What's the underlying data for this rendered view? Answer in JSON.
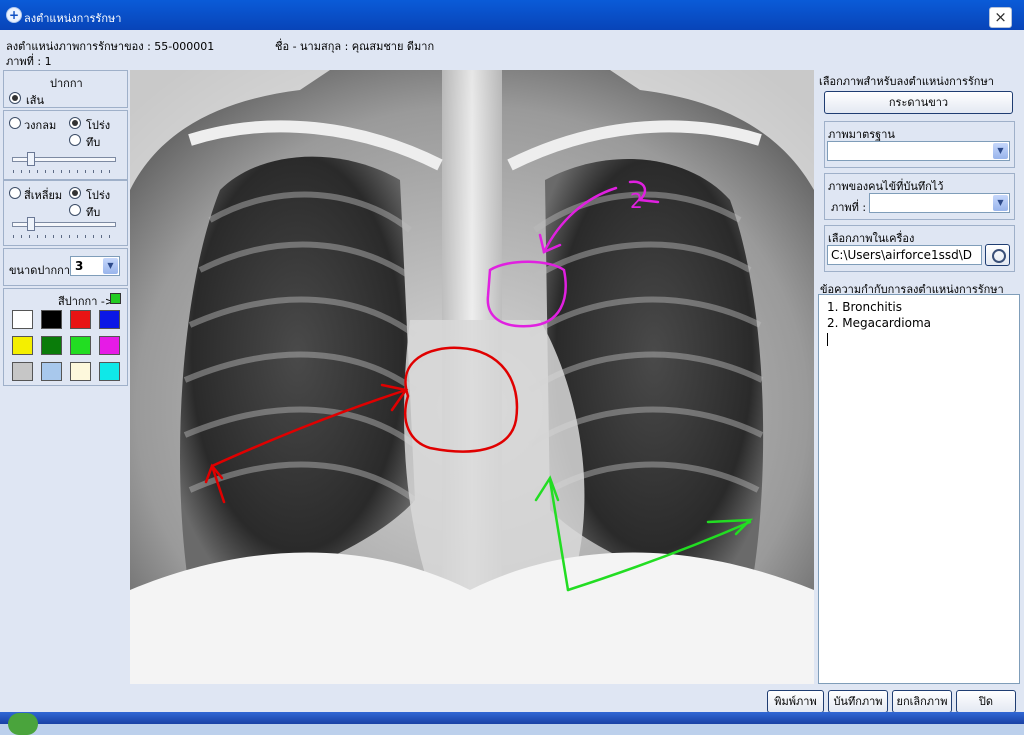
{
  "window": {
    "title": "ลงตำแหน่งการรักษา",
    "icon": "plus-circle-icon",
    "close_label": "×"
  },
  "info": {
    "patient_label": "ลงตำแหน่งภาพการรักษาของ : 55-000001",
    "name_label": "ชื่อ - นามสกุล : คุณสมชาย ดีมาก",
    "image_no": "ภาพที่ : 1"
  },
  "pen_tools": {
    "header": "ปากกา",
    "line_label": "เส้น",
    "circle_label": "วงกลม",
    "circle_transparent": "โปร่ง",
    "circle_solid": "ทึบ",
    "square_label": "สี่เหลี่ยม",
    "square_transparent": "โปร่ง",
    "square_solid": "ทึบ",
    "pen_size_label": "ขนาดปากกา",
    "pen_size_value": "3",
    "pen_color_label": "สีปากกา ->",
    "current_color": "#22cc22",
    "swatches": [
      "#ffffff",
      "#000000",
      "#e81414",
      "#0b17e6",
      "#f4ef00",
      "#0a7c0a",
      "#22dd22",
      "#e61be6",
      "#c6c6c6",
      "#a8c8ec",
      "#fdf8dc",
      "#0fe8e8"
    ]
  },
  "right": {
    "select_image_label": "เลือกภาพสำหรับลงตำแหน่งการรักษา",
    "whiteboard_button": "กระดานขาว",
    "standard_image_label": "ภาพมาตรฐาน",
    "standard_image_value": "",
    "patient_saved_label": "ภาพของคนไข้ที่บันทึกไว้",
    "image_no_label": "ภาพที่ :",
    "image_no_value": "",
    "local_image_label": "เลือกภาพในเครื่อง",
    "local_path": "C:\\Users\\airforce1ssd\\D",
    "notes_label": "ข้อความกำกับการลงตำแหน่งการรักษา",
    "notes": [
      "1. Bronchitis",
      "2. Megacardioma"
    ]
  },
  "annotation": {
    "label_2": "2"
  },
  "bottom": {
    "print_button": "พิมพ์ภาพ",
    "save_button": "บันทึกภาพ",
    "cancel_button": "ยกเลิกภาพ",
    "close_button": "ปิด"
  },
  "colors": {
    "title_bar": "#0a5bd8",
    "panel_bg": "#dfe6f3",
    "annotation_red": "#e00000",
    "annotation_magenta": "#e020e0",
    "annotation_green": "#22dd22"
  }
}
